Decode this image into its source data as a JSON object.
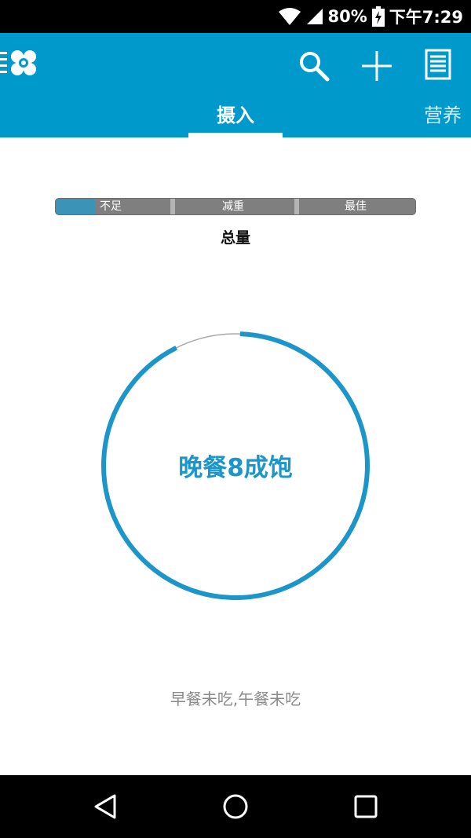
{
  "status_bar": {
    "battery": "80%",
    "time": "下午7:29"
  },
  "app_bar": {
    "icons": {
      "logo": "clover-list-icon",
      "search": "search-icon",
      "add": "plus-icon",
      "list": "document-list-icon"
    },
    "tabs": [
      {
        "label": "摄入",
        "selected": true
      },
      {
        "label": "营养",
        "selected": false
      }
    ]
  },
  "intake_level": {
    "segments": [
      "不足",
      "减重",
      "最佳"
    ],
    "current_fraction": 0.11,
    "caption": "总量"
  },
  "ring": {
    "progress_fraction": 0.92,
    "center_text": "晚餐8成饱"
  },
  "meals_status": "早餐未吃,午餐未吃",
  "nav_bar": {
    "icons": [
      "back-triangle-icon",
      "home-circle-icon",
      "recents-square-icon"
    ]
  },
  "colors": {
    "primary": "#0099cc",
    "ring": "#1c96c9",
    "level_fill": "#3b93b7",
    "level_track": "#7f7f7f"
  }
}
